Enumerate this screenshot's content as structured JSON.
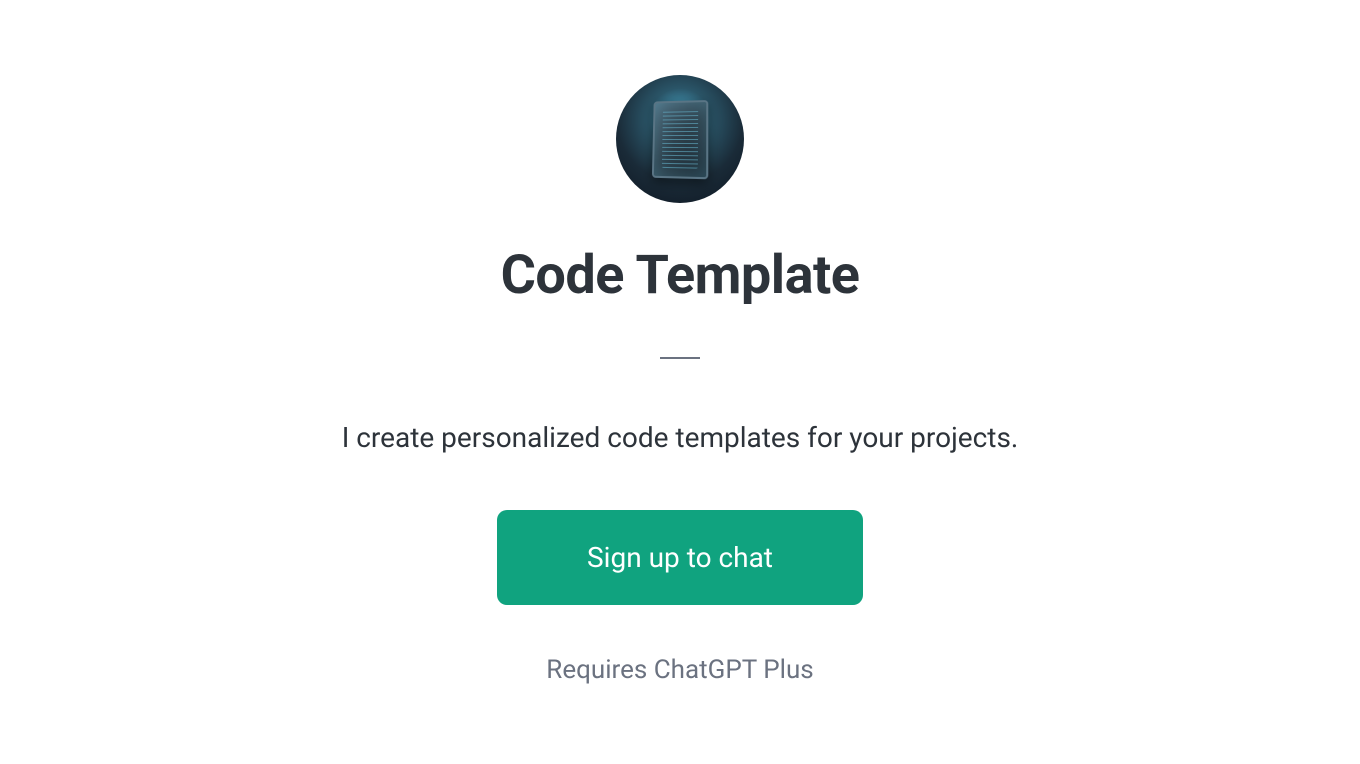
{
  "hero": {
    "title": "Code Template",
    "description": "I create personalized code templates for your projects.",
    "signup_button_label": "Sign up to chat",
    "requires_label": "Requires ChatGPT Plus",
    "avatar_icon": "code-tablet-icon"
  }
}
